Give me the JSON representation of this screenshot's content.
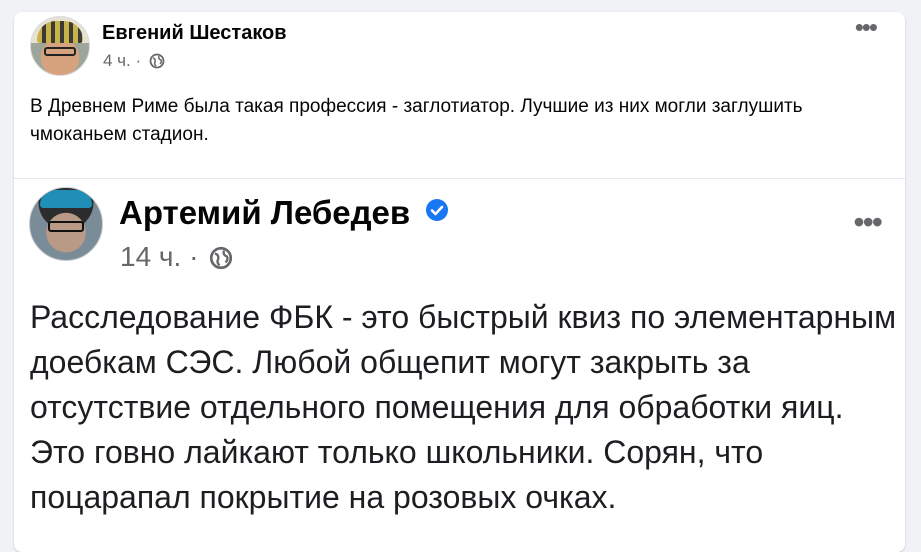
{
  "outer_post": {
    "author": "Евгений Шестаков",
    "time": "4 ч.",
    "separator": "·",
    "privacy_icon": "globe-icon",
    "more_icon": "more-dots-icon",
    "text": "В Древнем Риме была такая профессия - заглотиатор. Лучшие из них могли заглушить чмоканьем стадион."
  },
  "embedded_post": {
    "author": "Артемий Лебедев",
    "verified_icon": "verified-badge-icon",
    "time": "14 ч.",
    "separator": "·",
    "privacy_icon": "globe-icon",
    "more_icon": "more-dots-icon",
    "text": "Расследование ФБК - это быстрый квиз по элементарным доебкам СЭС. Любой общепит могут закрыть за отсутствие отдельного помещения для обработки яиц. Это говно лайкают только школьники. Сорян, что поцарапал покрытие на розовых очках."
  },
  "colors": {
    "background": "#f0f2f5",
    "card": "#ffffff",
    "primary_text": "#050505",
    "secondary_text": "#65676b",
    "verified": "#1877f2"
  }
}
